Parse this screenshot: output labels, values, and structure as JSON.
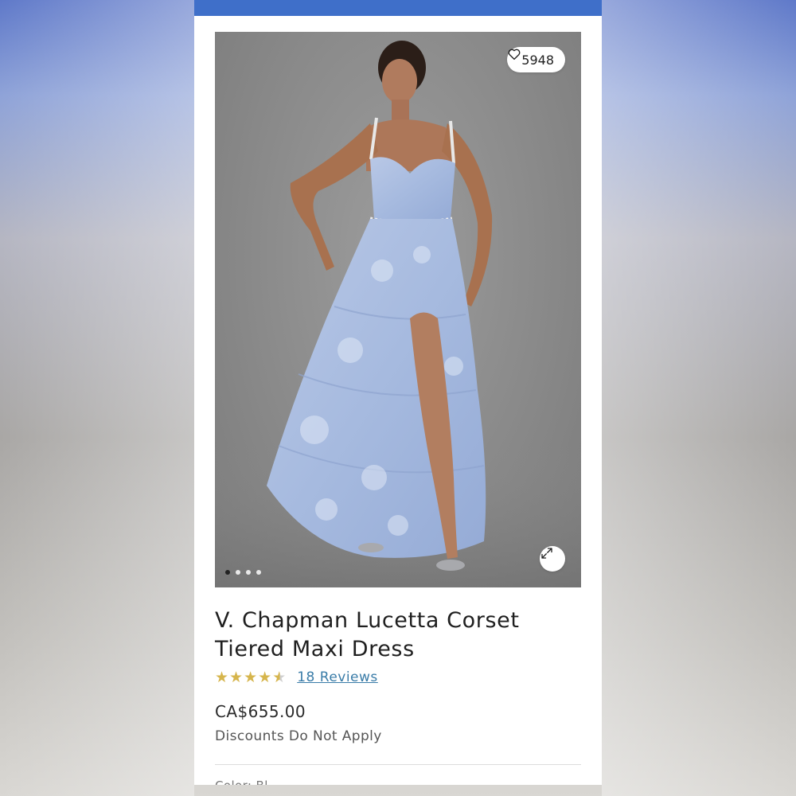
{
  "product": {
    "likes_count": "5948",
    "title": "V. Chapman Lucetta Corset Tiered Maxi Dress",
    "rating_value": 4.5,
    "rating_max": 5,
    "reviews_link": "18 Reviews",
    "price": "CA$655.00",
    "discount_note": "Discounts Do Not Apply",
    "color_label": "Color: Bl"
  },
  "gallery": {
    "image_count": 4,
    "active_index": 0
  },
  "icons": {
    "like": "heart-icon",
    "expand": "expand-icon"
  },
  "colors": {
    "topbar": "#3f6fc9",
    "star": "#d6b54c",
    "link": "#3a7ca8"
  }
}
